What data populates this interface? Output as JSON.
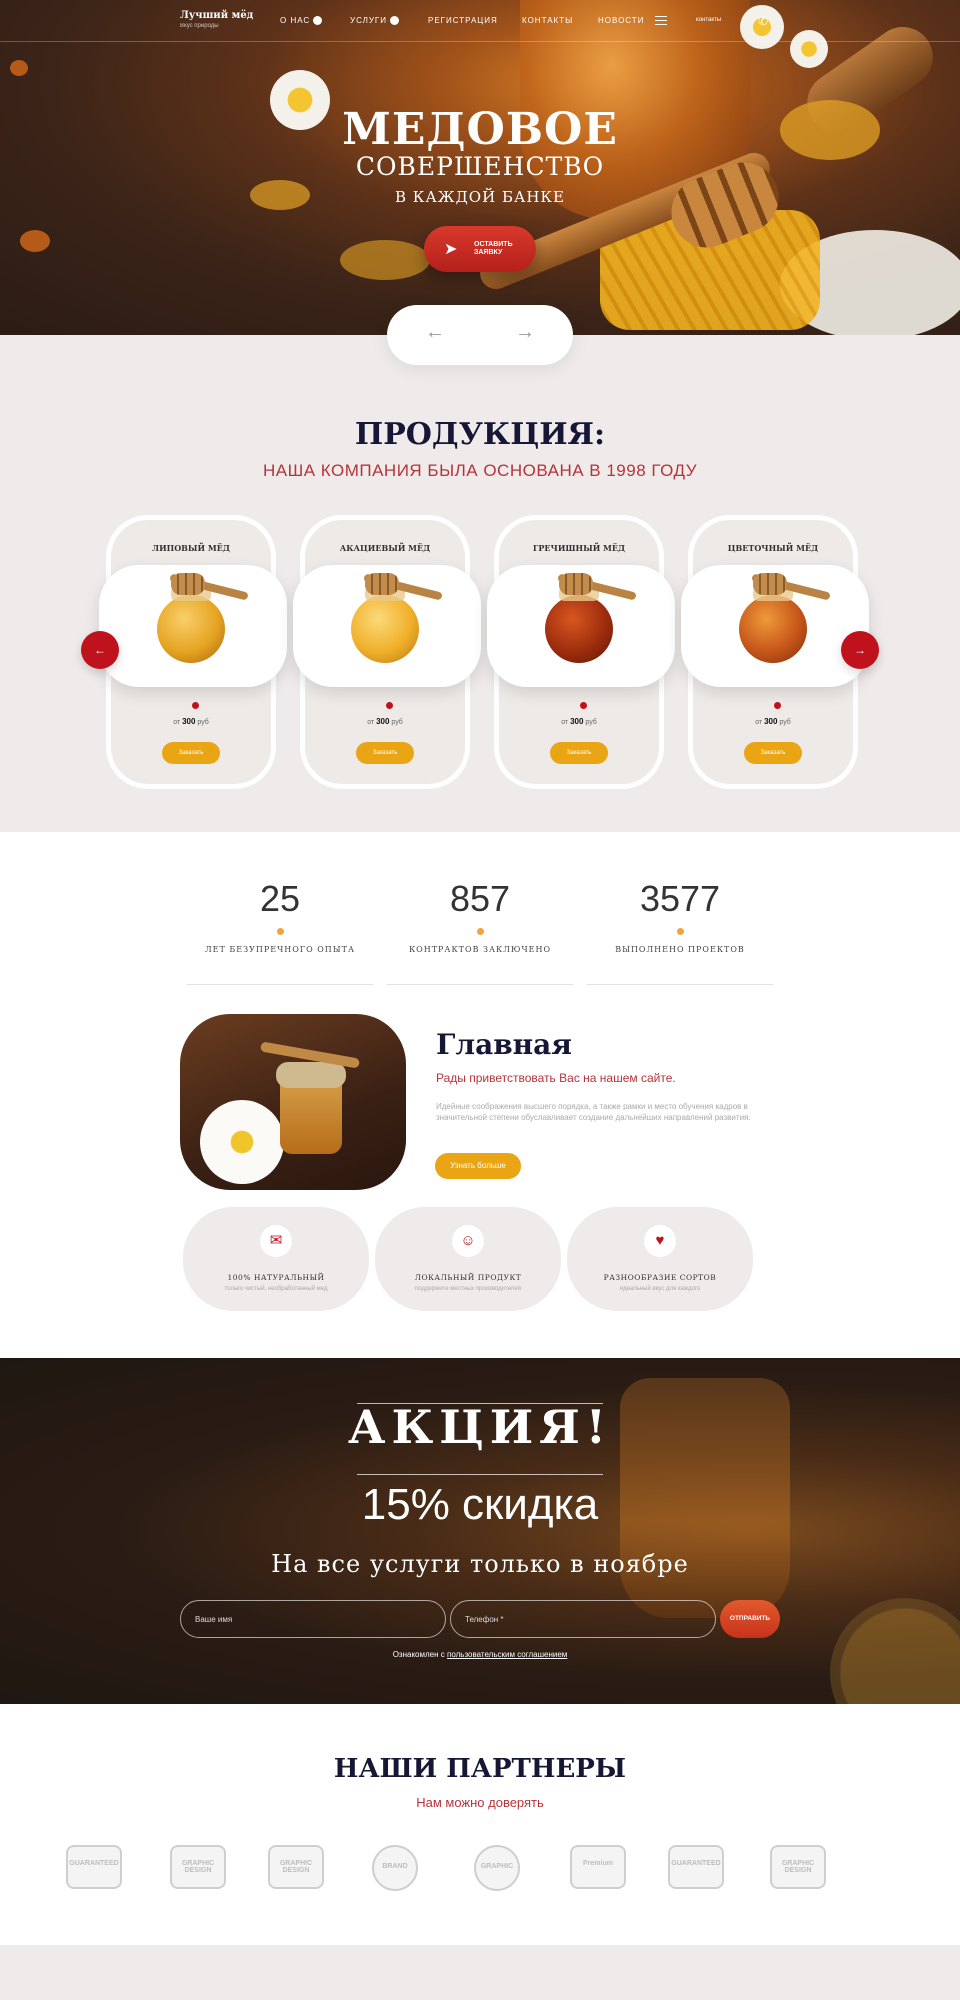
{
  "nav": {
    "brand_title": "Лучший мёд",
    "brand_sub": "Вкус природы",
    "items": [
      "О нас",
      "Услуги",
      "Регистрация",
      "Контакты",
      "Новости"
    ],
    "contacts_small": "контакты"
  },
  "hero": {
    "title": "МЕДОВОЕ",
    "subtitle": "СОВЕРШЕНСТВО",
    "subtitle2": "В КАЖДОЙ БАНКЕ",
    "cta_line1": "оставить",
    "cta_line2": "заявку",
    "prev_arrow": "←",
    "next_arrow": "→"
  },
  "products": {
    "title": "ПРОДУКЦИЯ:",
    "subtitle": "НАША КОМПАНИЯ БЫЛА ОСНОВАНА В 1998 ГОДУ",
    "items": [
      {
        "name": "ЛИПОВЫЙ МЁД",
        "price_prefix": "от",
        "price": "300",
        "currency": "руб",
        "button": "Заказать",
        "color": "#e6a422"
      },
      {
        "name": "АКАЦИЕВЫЙ МЁД",
        "price_prefix": "от",
        "price": "300",
        "currency": "руб",
        "button": "Заказать",
        "color": "#f0b02a"
      },
      {
        "name": "ГРЕЧИШНЫЙ МЁД",
        "price_prefix": "от",
        "price": "300",
        "currency": "руб",
        "button": "Заказать",
        "color": "#9e2d0e"
      },
      {
        "name": "ЦВЕТОЧНЫЙ МЁД",
        "price_prefix": "от",
        "price": "300",
        "currency": "руб",
        "button": "Заказать",
        "color": "#c6561a"
      }
    ],
    "prev_arrow": "←",
    "next_arrow": "→"
  },
  "stats": [
    {
      "num": "25",
      "label": "ЛЕТ БЕЗУПРЕЧНОГО ОПЫТА"
    },
    {
      "num": "857",
      "label": "КОНТРАКТОВ ЗАКЛЮЧЕНО"
    },
    {
      "num": "3577",
      "label": "ВЫПОЛНЕНО ПРОЕКТОВ"
    }
  ],
  "about": {
    "title": "Главная",
    "subtitle": "Рады приветствовать Вас на нашем сайте.",
    "text": "Идейные соображения высшего порядка, а также рамки и место обучения кадров в значительной степени обуславливает создание дальнейших направлений развития.",
    "button": "Узнать больше"
  },
  "features": [
    {
      "icon": "certificate-icon",
      "glyph": "✉",
      "title": "100% НАТУРАЛЬНЫЙ",
      "sub": "только чистый, необработанный мед"
    },
    {
      "icon": "beekeeper-icon",
      "glyph": "☺",
      "title": "ЛОКАЛЬНЫЙ ПРОДУКТ",
      "sub": "поддержите местных производителей"
    },
    {
      "icon": "honey-jar-icon",
      "glyph": "♥",
      "title": "РАЗНООБРАЗИЕ СОРТОВ",
      "sub": "идеальный вкус для каждого"
    }
  ],
  "promo": {
    "title": "АКЦИЯ!",
    "discount": "15% скидка",
    "subtitle": "На все услуги только в ноябре",
    "name_placeholder": "Ваше имя",
    "phone_placeholder": "Телефон *",
    "send": "Отправить",
    "consent_prefix": "Ознакомлен с",
    "consent_link": "пользовательским соглашением"
  },
  "partners": {
    "title": "НАШИ ПАРТНЕРЫ",
    "subtitle": "Нам можно доверять",
    "logos": [
      "GUARANTEED",
      "GRAPHIC DESIGN",
      "GRAPHIC DESIGN",
      "BRAND",
      "GRAPHIC",
      "Premium",
      "GUARANTEED",
      "GRAPHIC DESIGN"
    ]
  },
  "colors": {
    "accent_red": "#c0121c",
    "accent_gold": "#e9a514",
    "navy": "#161636"
  }
}
